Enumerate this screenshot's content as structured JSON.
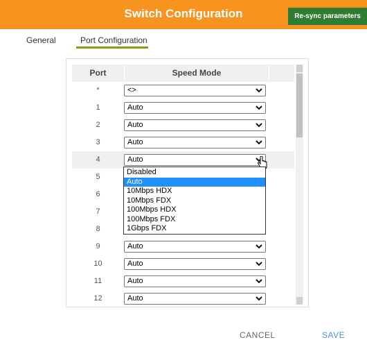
{
  "header": {
    "title": "Switch Configuration",
    "resync_label": "Re-sync parameters"
  },
  "tabs": [
    {
      "label": "General",
      "active": false
    },
    {
      "label": "Port Configuration",
      "active": true
    }
  ],
  "table": {
    "columns": [
      "Port",
      "Speed Mode"
    ],
    "rows": [
      {
        "port": "*",
        "value": "<>"
      },
      {
        "port": "1",
        "value": "Auto"
      },
      {
        "port": "2",
        "value": "Auto"
      },
      {
        "port": "3",
        "value": "Auto"
      },
      {
        "port": "4",
        "value": "Auto",
        "open": true
      },
      {
        "port": "5",
        "value": ""
      },
      {
        "port": "6",
        "value": ""
      },
      {
        "port": "7",
        "value": ""
      },
      {
        "port": "8",
        "value": ""
      },
      {
        "port": "9",
        "value": "Auto"
      },
      {
        "port": "10",
        "value": "Auto"
      },
      {
        "port": "11",
        "value": "Auto"
      },
      {
        "port": "12",
        "value": "Auto"
      }
    ]
  },
  "dropdown": {
    "options": [
      "Disabled",
      "Auto",
      "10Mbps HDX",
      "10Mbps FDX",
      "100Mbps HDX",
      "100Mbps FDX",
      "1Gbps FDX"
    ],
    "selected": "Auto"
  },
  "footer": {
    "cancel_label": "CANCEL",
    "save_label": "SAVE"
  },
  "colors": {
    "header_bg": "#f7931e",
    "resync_bg": "#2e7d32",
    "tab_underline": "#8a9a1e",
    "highlight": "#1e90ff",
    "save": "#4a90e2"
  }
}
